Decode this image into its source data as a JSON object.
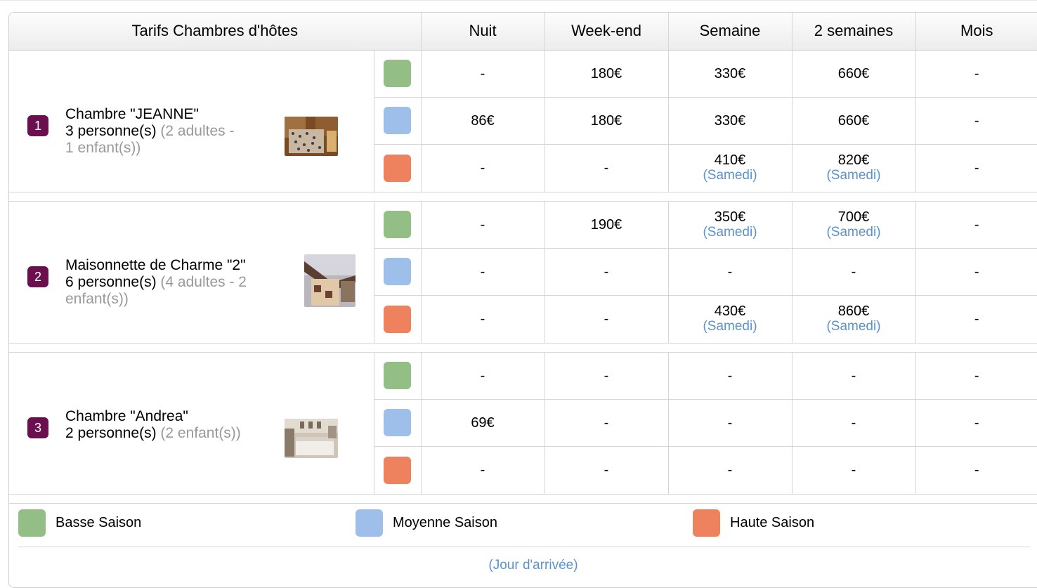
{
  "colors": {
    "basse": "#93bf86",
    "moyenne": "#9dbfe9",
    "haute": "#ee825f",
    "room_badge": "#6b0f4e",
    "link": "#5b93c9"
  },
  "header": {
    "title": "Tarifs Chambres d'hôtes",
    "columns": [
      "Nuit",
      "Week-end",
      "Semaine",
      "2 semaines",
      "Mois"
    ]
  },
  "rooms": [
    {
      "number": "1",
      "name": "Chambre \"JEANNE\"",
      "capacity": "3 personne(s)",
      "detail_line1": "(2 adultes -",
      "detail_line2": "1 enfant(s))",
      "rows": [
        {
          "season": "basse",
          "nuit": "-",
          "weekend": "180€",
          "semaine": "330€",
          "semaine_note": "",
          "deux_semaines": "660€",
          "deux_semaines_note": "",
          "mois": "-"
        },
        {
          "season": "moyenne",
          "nuit": "86€",
          "weekend": "180€",
          "semaine": "330€",
          "semaine_note": "",
          "deux_semaines": "660€",
          "deux_semaines_note": "",
          "mois": "-"
        },
        {
          "season": "haute",
          "nuit": "-",
          "weekend": "-",
          "semaine": "410€",
          "semaine_note": "(Samedi)",
          "deux_semaines": "820€",
          "deux_semaines_note": "(Samedi)",
          "mois": "-"
        }
      ]
    },
    {
      "number": "2",
      "name": "Maisonnette de Charme \"2\"",
      "capacity": "6 personne(s)",
      "detail_line1": "(4 adultes - 2",
      "detail_line2": "enfant(s))",
      "rows": [
        {
          "season": "basse",
          "nuit": "-",
          "weekend": "190€",
          "semaine": "350€",
          "semaine_note": "(Samedi)",
          "deux_semaines": "700€",
          "deux_semaines_note": "(Samedi)",
          "mois": "-"
        },
        {
          "season": "moyenne",
          "nuit": "-",
          "weekend": "-",
          "semaine": "-",
          "semaine_note": "",
          "deux_semaines": "-",
          "deux_semaines_note": "",
          "mois": "-"
        },
        {
          "season": "haute",
          "nuit": "-",
          "weekend": "-",
          "semaine": "430€",
          "semaine_note": "(Samedi)",
          "deux_semaines": "860€",
          "deux_semaines_note": "(Samedi)",
          "mois": "-"
        }
      ]
    },
    {
      "number": "3",
      "name": "Chambre \"Andrea\"",
      "capacity": "2 personne(s)",
      "detail_line1": "(2 enfant(s))",
      "detail_line2": "",
      "rows": [
        {
          "season": "basse",
          "nuit": "-",
          "weekend": "-",
          "semaine": "-",
          "semaine_note": "",
          "deux_semaines": "-",
          "deux_semaines_note": "",
          "mois": "-"
        },
        {
          "season": "moyenne",
          "nuit": "69€",
          "weekend": "-",
          "semaine": "-",
          "semaine_note": "",
          "deux_semaines": "-",
          "deux_semaines_note": "",
          "mois": "-"
        },
        {
          "season": "haute",
          "nuit": "-",
          "weekend": "-",
          "semaine": "-",
          "semaine_note": "",
          "deux_semaines": "-",
          "deux_semaines_note": "",
          "mois": "-"
        }
      ]
    }
  ],
  "legend": {
    "basse_label": "Basse Saison",
    "moyenne_label": "Moyenne Saison",
    "haute_label": "Haute Saison",
    "arrival_note": "(Jour d'arrivée)"
  }
}
